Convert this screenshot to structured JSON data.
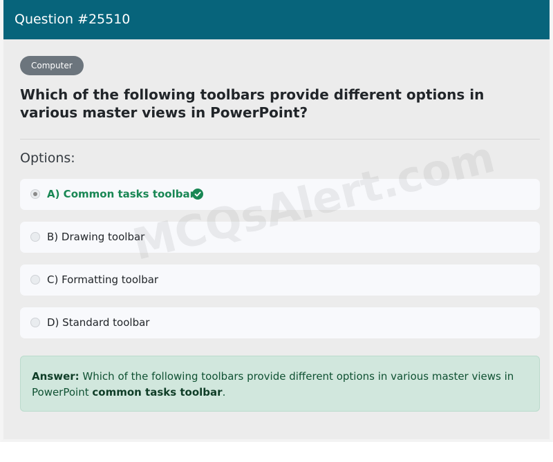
{
  "header": {
    "title": "Question #25510"
  },
  "category": "Computer",
  "question": "Which of the following toolbars provide different options in various master views in PowerPoint?",
  "options_label": "Options:",
  "options": [
    {
      "label": "A) Common tasks toolbar",
      "selected": true,
      "correct": true
    },
    {
      "label": "B) Drawing toolbar",
      "selected": false,
      "correct": false
    },
    {
      "label": "C) Formatting toolbar",
      "selected": false,
      "correct": false
    },
    {
      "label": "D) Standard toolbar",
      "selected": false,
      "correct": false
    }
  ],
  "answer": {
    "prefix": "Answer:",
    "text": " Which of the following toolbars provide different options in various master views in PowerPoint ",
    "highlight": "common tasks toolbar",
    "suffix": "."
  },
  "watermark": "MCQsAlert.com",
  "colors": {
    "header": "#07647b",
    "correct": "#198754",
    "answer_bg": "#d1e7dd"
  },
  "icons": {
    "correct": "check-circle-icon"
  }
}
